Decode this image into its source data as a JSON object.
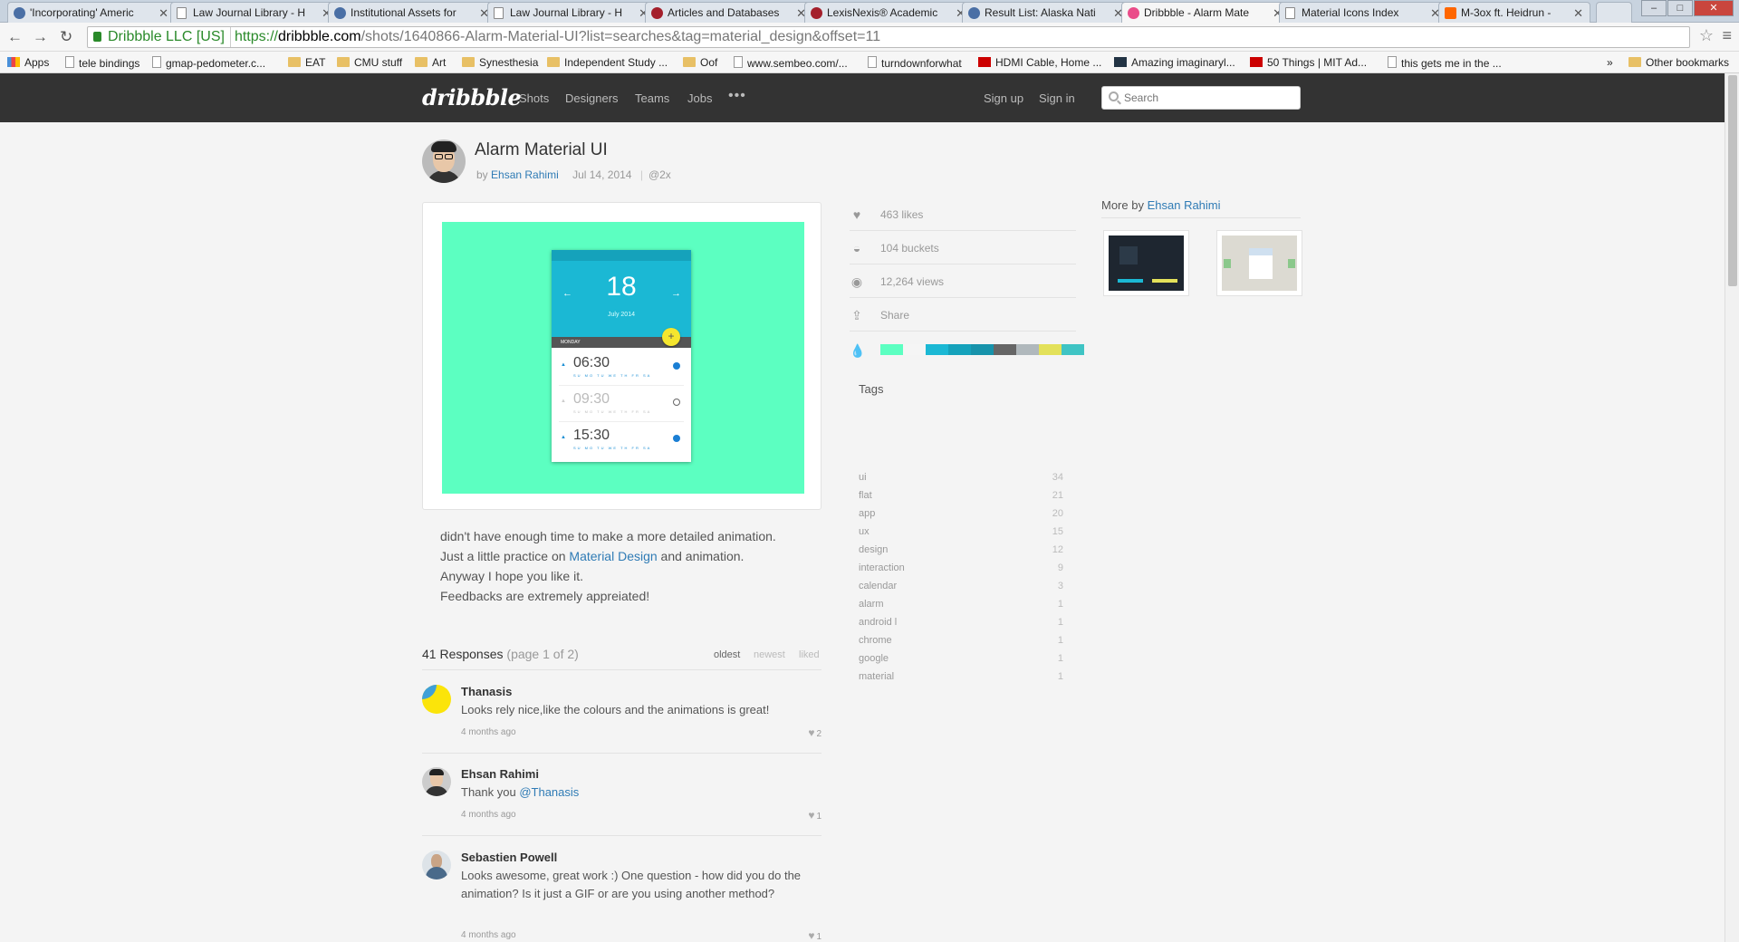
{
  "browser": {
    "tabs": [
      {
        "title": "'Incorporating' Americ",
        "icon": "e-icon",
        "active": false
      },
      {
        "title": "Law Journal Library - H",
        "icon": "doc-icon",
        "active": false
      },
      {
        "title": "Institutional Assets for",
        "icon": "e-icon",
        "active": false
      },
      {
        "title": "Law Journal Library - H",
        "icon": "doc-icon",
        "active": false
      },
      {
        "title": "Articles and Databases",
        "icon": "cmu-icon",
        "active": false
      },
      {
        "title": "LexisNexis® Academic",
        "icon": "lexis-icon",
        "active": false
      },
      {
        "title": "Result List: Alaska Nati",
        "icon": "e-icon",
        "active": false
      },
      {
        "title": "Dribbble - Alarm Mate",
        "icon": "dribbble-icon",
        "active": true
      },
      {
        "title": "Material Icons Index",
        "icon": "doc-icon",
        "active": false
      },
      {
        "title": "M-3ox ft. Heidrun -",
        "icon": "soundcloud-icon",
        "active": false
      }
    ],
    "address": {
      "ev_label": "Dribbble LLC [US]",
      "scheme": "https://",
      "host": "dribbble.com",
      "path": "/shots/1640866-Alarm-Material-UI?list=searches&tag=material_design&offset=11"
    },
    "bookmarks": [
      {
        "label": "Apps",
        "icon": "grid"
      },
      {
        "label": "tele bindings",
        "icon": "page"
      },
      {
        "label": "gmap-pedometer.c...",
        "icon": "page"
      },
      {
        "label": "EAT",
        "icon": "folder"
      },
      {
        "label": "CMU stuff",
        "icon": "folder"
      },
      {
        "label": "Art",
        "icon": "folder"
      },
      {
        "label": "Synesthesia",
        "icon": "folder"
      },
      {
        "label": "Independent Study ...",
        "icon": "folder"
      },
      {
        "label": "Oof",
        "icon": "folder"
      },
      {
        "label": "www.sembeo.com/...",
        "icon": "page"
      },
      {
        "label": "turndownforwhat",
        "icon": "page"
      },
      {
        "label": "HDMI Cable, Home ...",
        "icon": "red"
      },
      {
        "label": "Amazing imaginaryl...",
        "icon": "dark"
      },
      {
        "label": "50 Things | MIT Ad...",
        "icon": "red"
      },
      {
        "label": "this gets me in the ...",
        "icon": "page"
      }
    ],
    "bookmarks_overflow": "»",
    "other_bookmarks": "Other bookmarks"
  },
  "site": {
    "logo": "dribbble",
    "nav": [
      "Shots",
      "Designers",
      "Teams",
      "Jobs"
    ],
    "nav_more": "•••",
    "sign_up": "Sign up",
    "sign_in": "Sign in",
    "search_placeholder": "Search"
  },
  "shot": {
    "title": "Alarm Material UI",
    "by": "by",
    "author": "Ehsan Rahimi",
    "date": "Jul 14, 2014",
    "resolution": "@2x",
    "preview": {
      "day": "18",
      "month": "July 2014",
      "weekday": "MONDAY",
      "fab": "+",
      "alarms": [
        {
          "time": "06:30",
          "on": true,
          "days": "SU MO TU WE TH FR SA"
        },
        {
          "time": "09:30",
          "on": false,
          "days": "SU MO TU WE TH FR SA"
        },
        {
          "time": "15:30",
          "on": true,
          "days": "SU MO TU WE TH FR SA"
        }
      ]
    },
    "description": [
      "didn't have enough time to make a more detailed animation.",
      "Just a little practice on ",
      "Material Design",
      " and animation.",
      "Anyway I hope you like it.",
      "Feedbacks are extremely appreiated!"
    ]
  },
  "stats": {
    "likes": "463 likes",
    "buckets": "104 buckets",
    "views": "12,264 views",
    "share": "Share",
    "palette": [
      "#5cffc1",
      "#f5f5f5",
      "#1bb8d4",
      "#15a2bb",
      "#1793ab",
      "#666666",
      "#b0b8bc",
      "#e3e15a",
      "#3fc4c4"
    ]
  },
  "tags": {
    "heading": "Tags",
    "items": [
      {
        "name": "ui",
        "count": "34"
      },
      {
        "name": "flat",
        "count": "21"
      },
      {
        "name": "app",
        "count": "20"
      },
      {
        "name": "ux",
        "count": "15"
      },
      {
        "name": "design",
        "count": "12"
      },
      {
        "name": "interaction",
        "count": "9"
      },
      {
        "name": "calendar",
        "count": "3"
      },
      {
        "name": "alarm",
        "count": "1"
      },
      {
        "name": "android l",
        "count": "1"
      },
      {
        "name": "chrome",
        "count": "1"
      },
      {
        "name": "google",
        "count": "1"
      },
      {
        "name": "material",
        "count": "1"
      }
    ]
  },
  "more": {
    "prefix": "More by",
    "author": "Ehsan Rahimi"
  },
  "responses": {
    "count": "41 Responses",
    "page": "(page 1 of 2)",
    "sort": [
      "oldest",
      "newest",
      "liked"
    ],
    "items": [
      {
        "name": "Thanasis",
        "text": "Looks rely nice,like the colours and the animations is great!",
        "mention": "",
        "date": "4 months ago",
        "likes": "2"
      },
      {
        "name": "Ehsan Rahimi",
        "text": "Thank you ",
        "mention": "@Thanasis",
        "date": "4 months ago",
        "likes": "1"
      },
      {
        "name": "Sebastien Powell",
        "text": "Looks awesome, great work :) One question - how did you do the animation? Is it just a GIF or are you using another method?",
        "mention": "",
        "date": "4 months ago",
        "likes": "1"
      }
    ]
  }
}
